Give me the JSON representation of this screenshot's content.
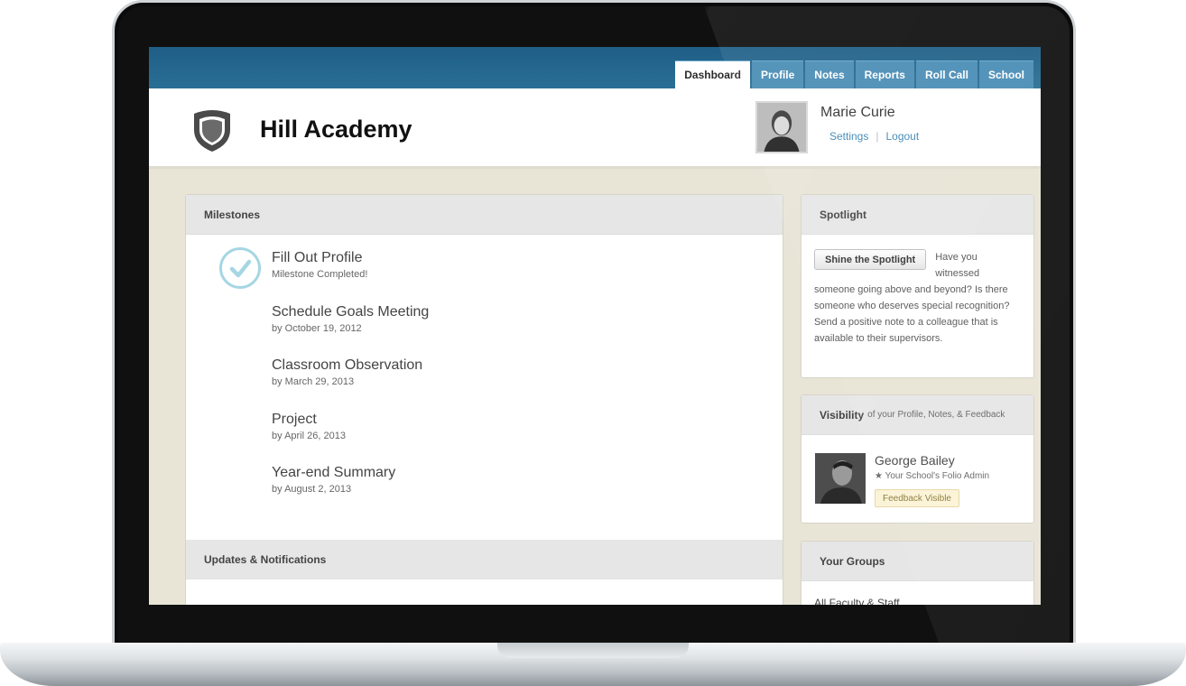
{
  "nav": {
    "tabs": [
      {
        "label": "Dashboard",
        "active": true
      },
      {
        "label": "Profile"
      },
      {
        "label": "Notes"
      },
      {
        "label": "Reports"
      },
      {
        "label": "Roll Call"
      },
      {
        "label": "School"
      }
    ]
  },
  "header": {
    "school_name": "Hill Academy",
    "logo_icon": "shield-icon",
    "user": {
      "name": "Marie Curie",
      "settings_link": "Settings",
      "separator": "|",
      "logout_link": "Logout"
    }
  },
  "milestones": {
    "title": "Milestones",
    "items": [
      {
        "title": "Fill Out Profile",
        "sub": "Milestone Completed!",
        "completed": true
      },
      {
        "title": "Schedule Goals Meeting",
        "sub": "by October 19, 2012"
      },
      {
        "title": "Classroom Observation",
        "sub": "by March 29, 2013"
      },
      {
        "title": "Project",
        "sub": "by April 26, 2013"
      },
      {
        "title": "Year-end Summary",
        "sub": "by August 2, 2013"
      }
    ]
  },
  "updates": {
    "title": "Updates & Notifications"
  },
  "spotlight": {
    "title": "Spotlight",
    "button_label": "Shine the Spotlight",
    "text": "Have you witnessed someone going above and beyond? Is there someone who deserves special recognition? Send a positive note to a colleague that is available to their supervisors."
  },
  "visibility": {
    "title": "Visibility",
    "subtitle": "of your Profile, Notes, & Feedback",
    "person": {
      "name": "George Bailey",
      "role": "★ Your School's Folio Admin",
      "badge": "Feedback Visible"
    }
  },
  "groups": {
    "title": "Your Groups",
    "items": [
      "All Faculty & Staff"
    ]
  },
  "colors": {
    "topbar": "#2a6f95",
    "tab": "#4a8db5",
    "link": "#3f87b8",
    "page_bg": "#e8e4d6",
    "check": "#a6d6e4"
  }
}
